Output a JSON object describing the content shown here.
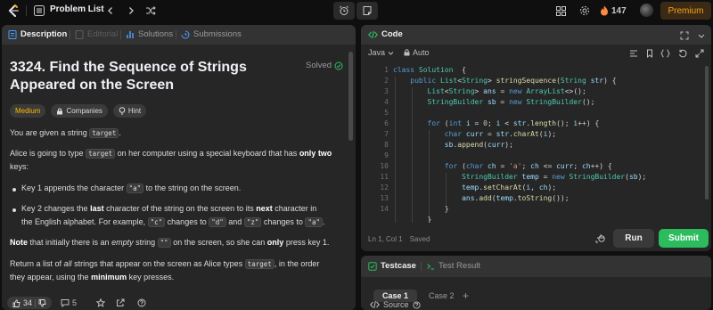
{
  "nav": {
    "title": "Problem List",
    "streak_count": "147",
    "premium_label": "Premium",
    "accent_color": "#ffa116"
  },
  "description_tabs": [
    {
      "label": "Description",
      "icon": "description-icon"
    },
    {
      "label": "Editorial",
      "icon": "editorial-icon"
    },
    {
      "label": "Solutions",
      "icon": "solutions-icon"
    },
    {
      "label": "Submissions",
      "icon": "submissions-icon"
    }
  ],
  "problem": {
    "title_line1": "3324. Find the Sequence of Strings",
    "title_line2": "Appeared on the Screen",
    "status": "Solved",
    "difficulty": "Medium",
    "companies_label": "Companies",
    "hint_label": "Hint",
    "p1_a": "You are given a string",
    "p1_code": "target",
    "p1_b": ".",
    "p2_a": "Alice is going to type",
    "p2_code": "target",
    "p2_b": "on her computer using a special keyboard that has",
    "p2_bold": "only two",
    "p2_c": "keys:",
    "b1_a": "Key 1 appends the character",
    "b1_code": "\"a\"",
    "b1_b": "to the string on the screen.",
    "b2_a": "Key 2 changes the",
    "b2_bold1": "last",
    "b2_b": "character of the string on the screen to its",
    "b2_bold2": "next",
    "b2_c": "character in",
    "b2_d": "the English alphabet. For example,",
    "b2_code1": "\"c\"",
    "b2_e": "changes to",
    "b2_code2": "\"d\"",
    "b2_f": "and",
    "b2_code3": "\"z\"",
    "b2_g": "changes to",
    "b2_code4": "\"a\"",
    "b2_h": ".",
    "note_bold": "Note",
    "note_a": "that initially there is an",
    "note_em": "empty",
    "note_b": "string",
    "note_code": "\"\"",
    "note_c": "on the screen, so she can",
    "note_bold2": "only",
    "note_d": "press key 1.",
    "ret_a": "Return a list of",
    "ret_em": "all",
    "ret_b": "strings that appear on the screen as Alice types",
    "ret_code": "target",
    "ret_c": ", in the order",
    "ret_d": "they appear, using the",
    "ret_bold": "minimum",
    "ret_e": "key presses."
  },
  "footer": {
    "likes": "34",
    "comments": "5"
  },
  "code_panel": {
    "title": "Code",
    "language": "Java",
    "autosave": "Auto",
    "cursor_pos": "Ln 1, Col 1",
    "save_status": "Saved",
    "run_label": "Run",
    "submit_label": "Submit",
    "submit_color": "#2cbb5d",
    "line_numbers": [
      "1",
      "2",
      "3",
      "4",
      "5",
      "6",
      "7",
      "8",
      "9",
      "10",
      "11",
      "12",
      "13",
      "14"
    ]
  },
  "test_panel": {
    "testcase_label": "Testcase",
    "result_label": "Test Result",
    "case_tabs": [
      "Case 1",
      "Case 2"
    ],
    "source_label": "Source"
  }
}
